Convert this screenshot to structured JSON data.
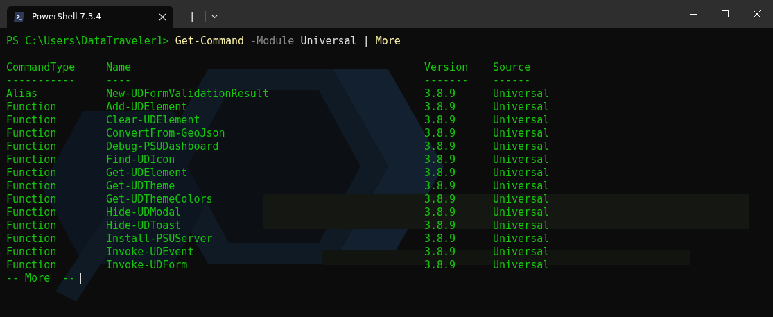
{
  "tabs": [
    {
      "title": "PowerShell 7.3.4",
      "selected": true
    }
  ],
  "tab_bar": {
    "new_tab": "+"
  },
  "terminal": {
    "command": [
      {
        "kind": "prompt",
        "text": "PS C:\\Users\\DataTraveler1>"
      },
      {
        "kind": "cmdlet",
        "text": "Get-Command"
      },
      {
        "kind": "parameter",
        "text": "-Module"
      },
      {
        "kind": "argument",
        "text": "Universal"
      },
      {
        "kind": "operator",
        "text": "|"
      },
      {
        "kind": "cmdlet",
        "text": "More"
      }
    ],
    "columns": [
      "CommandType",
      "Name",
      "Version",
      "Source"
    ],
    "underlines": [
      "-----------",
      "----",
      "-------",
      "------"
    ],
    "rows": [
      [
        "Alias",
        "New-UDFormValidationResult",
        "3.8.9",
        "Universal"
      ],
      [
        "Function",
        "Add-UDElement",
        "3.8.9",
        "Universal"
      ],
      [
        "Function",
        "Clear-UDElement",
        "3.8.9",
        "Universal"
      ],
      [
        "Function",
        "ConvertFrom-GeoJson",
        "3.8.9",
        "Universal"
      ],
      [
        "Function",
        "Debug-PSUDashboard",
        "3.8.9",
        "Universal"
      ],
      [
        "Function",
        "Find-UDIcon",
        "3.8.9",
        "Universal"
      ],
      [
        "Function",
        "Get-UDElement",
        "3.8.9",
        "Universal"
      ],
      [
        "Function",
        "Get-UDTheme",
        "3.8.9",
        "Universal"
      ],
      [
        "Function",
        "Get-UDThemeColors",
        "3.8.9",
        "Universal"
      ],
      [
        "Function",
        "Hide-UDModal",
        "3.8.9",
        "Universal"
      ],
      [
        "Function",
        "Hide-UDToast",
        "3.8.9",
        "Universal"
      ],
      [
        "Function",
        "Install-PSUServer",
        "3.8.9",
        "Universal"
      ],
      [
        "Function",
        "Invoke-UDEvent",
        "3.8.9",
        "Universal"
      ],
      [
        "Function",
        "Invoke-UDForm",
        "3.8.9",
        "Universal"
      ]
    ],
    "pager": "-- More  --"
  }
}
